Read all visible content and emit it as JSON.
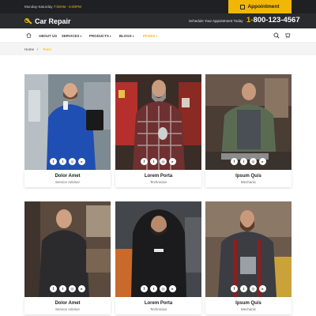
{
  "topbar": {
    "hours_prefix": "Monday-Saturday",
    "hours_time": "7:00AM - 6:00PM",
    "appointment_label": "Appointment"
  },
  "header": {
    "logo_text": "Car Repair",
    "schedule_text": "Schedule Your Appointment Today",
    "phone_prefix": "1-",
    "phone_rest": "800-123-4567"
  },
  "nav": {
    "items": [
      {
        "label": "ABOUT US",
        "caret": ""
      },
      {
        "label": "SERVICES",
        "caret": "▾"
      },
      {
        "label": "PRODUCTS",
        "caret": "▾"
      },
      {
        "label": "BLOGS",
        "caret": "▾"
      },
      {
        "label": "PAGES",
        "caret": "▾"
      }
    ]
  },
  "breadcrumb": {
    "home": "Home",
    "separator": "/",
    "current": "Team"
  },
  "team": [
    {
      "name": "Dolor Amet",
      "role": "Service Advisor"
    },
    {
      "name": "Lorem Porta",
      "role": "Technician"
    },
    {
      "name": "Ipsum Quis",
      "role": "Mechanic"
    },
    {
      "name": "Dolor Amet",
      "role": "Service Advisor"
    },
    {
      "name": "Lorem Porta",
      "role": "Technician"
    },
    {
      "name": "Ipsum Quis",
      "role": "Mechanic"
    }
  ],
  "social_icons": [
    "facebook-icon",
    "twitter-icon",
    "instagram-icon",
    "youtube-icon"
  ],
  "colors": {
    "accent": "#f2b705",
    "dark": "#1f2024",
    "header": "#2a2b2f"
  }
}
